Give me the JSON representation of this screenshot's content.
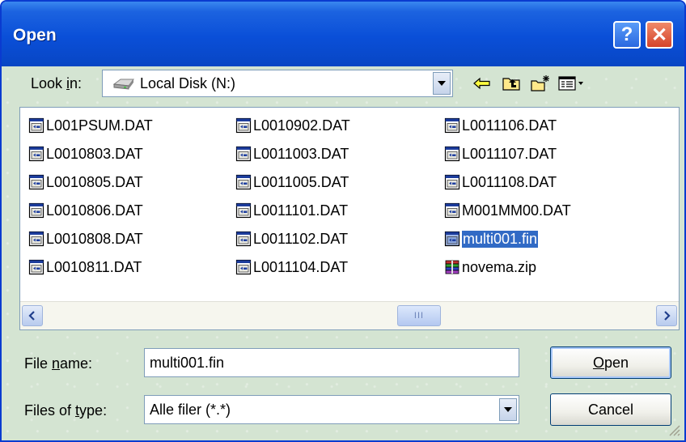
{
  "window": {
    "title": "Open"
  },
  "titlebar": {
    "help_label": "?",
    "close_label": "✕"
  },
  "look_in": {
    "label_prefix": "Look ",
    "label_accel": "i",
    "label_suffix": "n:",
    "value": "Local Disk (N:)"
  },
  "toolbar": {
    "icons": [
      "back-icon",
      "up-folder-icon",
      "new-folder-icon",
      "view-menu-icon"
    ]
  },
  "files": [
    [
      "L001PSUM.DAT",
      "L0010803.DAT",
      "L0010805.DAT",
      "L0010806.DAT",
      "L0010808.DAT",
      "L0010811.DAT"
    ],
    [
      "L0010902.DAT",
      "L0011003.DAT",
      "L0011005.DAT",
      "L0011101.DAT",
      "L0011102.DAT",
      "L0011104.DAT"
    ],
    [
      "L0011106.DAT",
      "L0011107.DAT",
      "L0011108.DAT",
      "M001MM00.DAT",
      "multi001.fin",
      "novema.zip"
    ]
  ],
  "selected_file": "multi001.fin",
  "scrollbar": {
    "thumb_grip": "III"
  },
  "file_name": {
    "label_prefix": "File ",
    "label_accel": "n",
    "label_suffix": "ame:",
    "value": "multi001.fin"
  },
  "file_type": {
    "label_prefix": "Files of ",
    "label_accel": "t",
    "label_suffix": "ype:",
    "value": "Alle filer (*.*)"
  },
  "buttons": {
    "open_accel": "O",
    "open_rest": "pen",
    "cancel": "Cancel"
  }
}
